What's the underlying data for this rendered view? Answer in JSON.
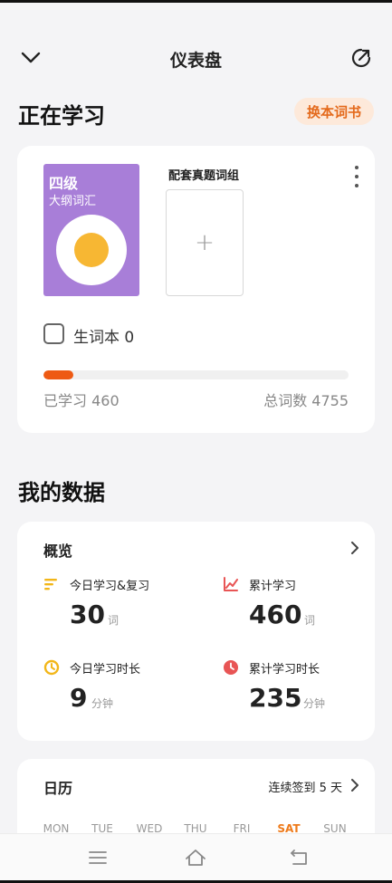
{
  "header": {
    "title": "仪表盘"
  },
  "studying": {
    "section_title": "正在学习",
    "switch_label": "换本词书",
    "book": {
      "cover_title": "四级",
      "cover_subtitle": "大纲词汇"
    },
    "paired_label": "配套真题词组",
    "add_symbol": "+",
    "wordbook_label": "生词本 0",
    "progress": {
      "learned_label": "已学习 460",
      "total_label": "总词数 4755",
      "learned": 460,
      "total": 4755
    }
  },
  "my_data": {
    "section_title": "我的数据",
    "overview": {
      "title": "概览",
      "stats": [
        {
          "label": "今日学习&复习",
          "value": "30",
          "unit": "词",
          "icon": "bars-icon",
          "color": "#f2b619"
        },
        {
          "label": "累计学习",
          "value": "460",
          "unit": "词",
          "icon": "line-chart-icon",
          "color": "#e85555"
        },
        {
          "label": "今日学习时长",
          "value": "9",
          "unit": "分钟",
          "icon": "moon-clock-icon",
          "color": "#f2b619"
        },
        {
          "label": "累计学习时长",
          "value": "235",
          "unit": "分钟",
          "icon": "clock-icon",
          "color": "#e85555"
        }
      ]
    },
    "calendar": {
      "title": "日历",
      "streak_label": "连续签到 5 天",
      "days": [
        "MON",
        "TUE",
        "WED",
        "THU",
        "FRI",
        "SAT",
        "SUN"
      ],
      "highlight_day": "SAT"
    }
  },
  "navbar": {
    "items": [
      "menu-icon",
      "home-icon",
      "back-icon"
    ]
  }
}
